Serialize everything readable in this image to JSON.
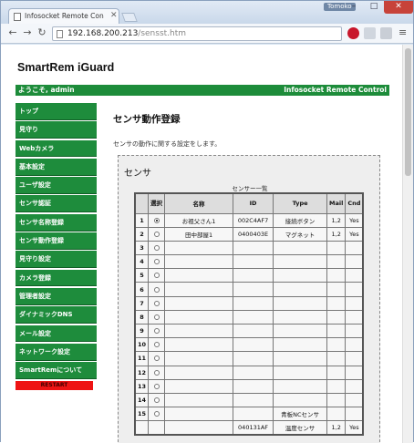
{
  "browser": {
    "user_badge": "Tomoko",
    "tab_title": "Infosocket Remote Con",
    "url_host": "192.168.200.213",
    "url_path": "/sensst.htm"
  },
  "site": {
    "title": "SmartRem iGuard",
    "welcome": "ようこそ, admin",
    "brand": "Infosocket Remote Control"
  },
  "sidebar": {
    "items": [
      {
        "label": "トップ"
      },
      {
        "label": "見守り"
      },
      {
        "label": "Webカメラ"
      },
      {
        "label": "基本設定"
      },
      {
        "label": "ユーザ設定"
      },
      {
        "label": "センサ認証"
      },
      {
        "label": "センサ名称登録"
      },
      {
        "label": "センサ動作登録"
      },
      {
        "label": "見守り設定"
      },
      {
        "label": "カメラ登録"
      },
      {
        "label": "管理者設定"
      },
      {
        "label": "ダイナミックDNS"
      },
      {
        "label": "メール設定"
      },
      {
        "label": "ネットワーク設定"
      },
      {
        "label": "SmartRemについて"
      }
    ],
    "restart": "RESTART"
  },
  "main": {
    "heading": "センサ動作登録",
    "description": "センサの動作に関する設定をします。",
    "panel_title": "センサ",
    "table_caption": "センサー一覧",
    "columns": {
      "select": "選択",
      "name": "名称",
      "id": "ID",
      "type": "Type",
      "mail": "Mail",
      "cnd": "Cnd"
    },
    "rows": [
      {
        "no": "1",
        "selected": true,
        "name": "お祖父さん1",
        "id": "002C4AF7",
        "type": "接続ボタン",
        "mail": "1,2",
        "cnd": "Yes"
      },
      {
        "no": "2",
        "selected": false,
        "name": "田中部屋1",
        "id": "0400403E",
        "type": "マグネット",
        "mail": "1,2",
        "cnd": "Yes"
      },
      {
        "no": "3",
        "selected": false,
        "name": "",
        "id": "",
        "type": "",
        "mail": "",
        "cnd": ""
      },
      {
        "no": "4",
        "selected": false,
        "name": "",
        "id": "",
        "type": "",
        "mail": "",
        "cnd": ""
      },
      {
        "no": "5",
        "selected": false,
        "name": "",
        "id": "",
        "type": "",
        "mail": "",
        "cnd": ""
      },
      {
        "no": "6",
        "selected": false,
        "name": "",
        "id": "",
        "type": "",
        "mail": "",
        "cnd": ""
      },
      {
        "no": "7",
        "selected": false,
        "name": "",
        "id": "",
        "type": "",
        "mail": "",
        "cnd": ""
      },
      {
        "no": "8",
        "selected": false,
        "name": "",
        "id": "",
        "type": "",
        "mail": "",
        "cnd": ""
      },
      {
        "no": "9",
        "selected": false,
        "name": "",
        "id": "",
        "type": "",
        "mail": "",
        "cnd": ""
      },
      {
        "no": "10",
        "selected": false,
        "name": "",
        "id": "",
        "type": "",
        "mail": "",
        "cnd": ""
      },
      {
        "no": "11",
        "selected": false,
        "name": "",
        "id": "",
        "type": "",
        "mail": "",
        "cnd": ""
      },
      {
        "no": "12",
        "selected": false,
        "name": "",
        "id": "",
        "type": "",
        "mail": "",
        "cnd": ""
      },
      {
        "no": "13",
        "selected": false,
        "name": "",
        "id": "",
        "type": "",
        "mail": "",
        "cnd": ""
      },
      {
        "no": "14",
        "selected": false,
        "name": "",
        "id": "",
        "type": "",
        "mail": "",
        "cnd": ""
      },
      {
        "no": "15",
        "selected": false,
        "name": "",
        "id": "",
        "type": "青板NCセンサ",
        "mail": "",
        "cnd": ""
      },
      {
        "no": "",
        "selected": null,
        "name": "",
        "id": "040131AF",
        "type": "温度センサ",
        "mail": "1,2",
        "cnd": "Yes"
      }
    ]
  }
}
